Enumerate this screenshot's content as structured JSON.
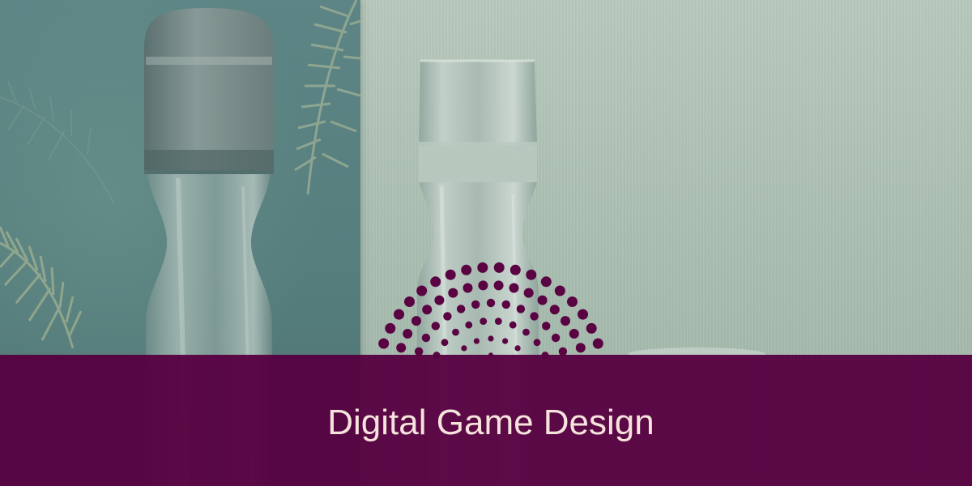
{
  "banner": {
    "title": "Digital Game Design"
  },
  "colors": {
    "band": "#560040",
    "title_text": "#f6e3dc",
    "dot": "#5a0342",
    "left_panel": "#557d7c",
    "wall": "#aebfb3"
  }
}
